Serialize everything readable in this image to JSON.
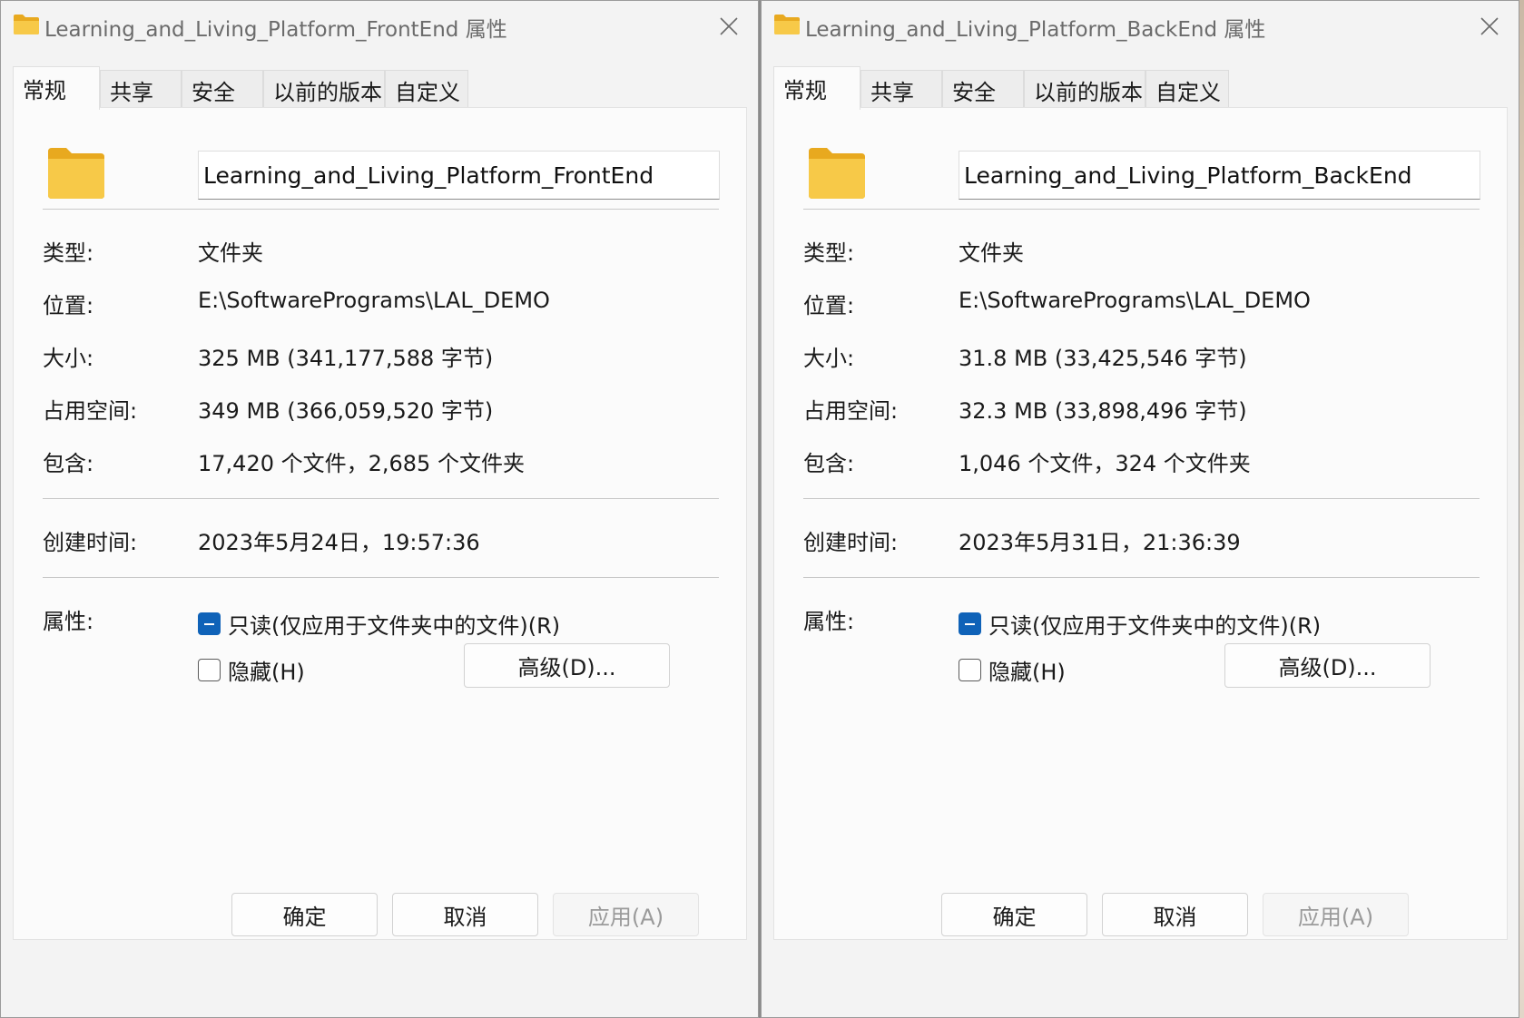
{
  "colors": {
    "accent": "#0f62b8",
    "folder": "#f7c948",
    "dialog_bg": "#f3f3f3"
  },
  "dialogs": [
    {
      "title": "Learning_and_Living_Platform_FrontEnd 属性",
      "tabs": [
        {
          "label": "常规",
          "active": true
        },
        {
          "label": "共享"
        },
        {
          "label": "安全"
        },
        {
          "label": "以前的版本"
        },
        {
          "label": "自定义"
        }
      ],
      "name": "Learning_and_Living_Platform_FrontEnd",
      "type_label": "类型:",
      "type_value": "文件夹",
      "location_label": "位置:",
      "location_value": "E:\\SoftwarePrograms\\LAL_DEMO",
      "size_label": "大小:",
      "size_value": "325 MB (341,177,588 字节)",
      "disk_label": "占用空间:",
      "disk_value": "349 MB (366,059,520 字节)",
      "contains_label": "包含:",
      "contains_value": "17,420 个文件，2,685 个文件夹",
      "created_label": "创建时间:",
      "created_value": "2023年5月24日，19:57:36",
      "attr_label": "属性:",
      "readonly_label": "只读(仅应用于文件夹中的文件)(R)",
      "hidden_label": "隐藏(H)",
      "advanced_button": "高级(D)...",
      "ok_button": "确定",
      "cancel_button": "取消",
      "apply_button": "应用(A)"
    },
    {
      "title": "Learning_and_Living_Platform_BackEnd 属性",
      "tabs": [
        {
          "label": "常规",
          "active": true
        },
        {
          "label": "共享"
        },
        {
          "label": "安全"
        },
        {
          "label": "以前的版本"
        },
        {
          "label": "自定义"
        }
      ],
      "name": "Learning_and_Living_Platform_BackEnd",
      "type_label": "类型:",
      "type_value": "文件夹",
      "location_label": "位置:",
      "location_value": "E:\\SoftwarePrograms\\LAL_DEMO",
      "size_label": "大小:",
      "size_value": "31.8 MB (33,425,546 字节)",
      "disk_label": "占用空间:",
      "disk_value": "32.3 MB (33,898,496 字节)",
      "contains_label": "包含:",
      "contains_value": "1,046 个文件，324 个文件夹",
      "created_label": "创建时间:",
      "created_value": "2023年5月31日，21:36:39",
      "attr_label": "属性:",
      "readonly_label": "只读(仅应用于文件夹中的文件)(R)",
      "hidden_label": "隐藏(H)",
      "advanced_button": "高级(D)...",
      "ok_button": "确定",
      "cancel_button": "取消",
      "apply_button": "应用(A)"
    }
  ]
}
